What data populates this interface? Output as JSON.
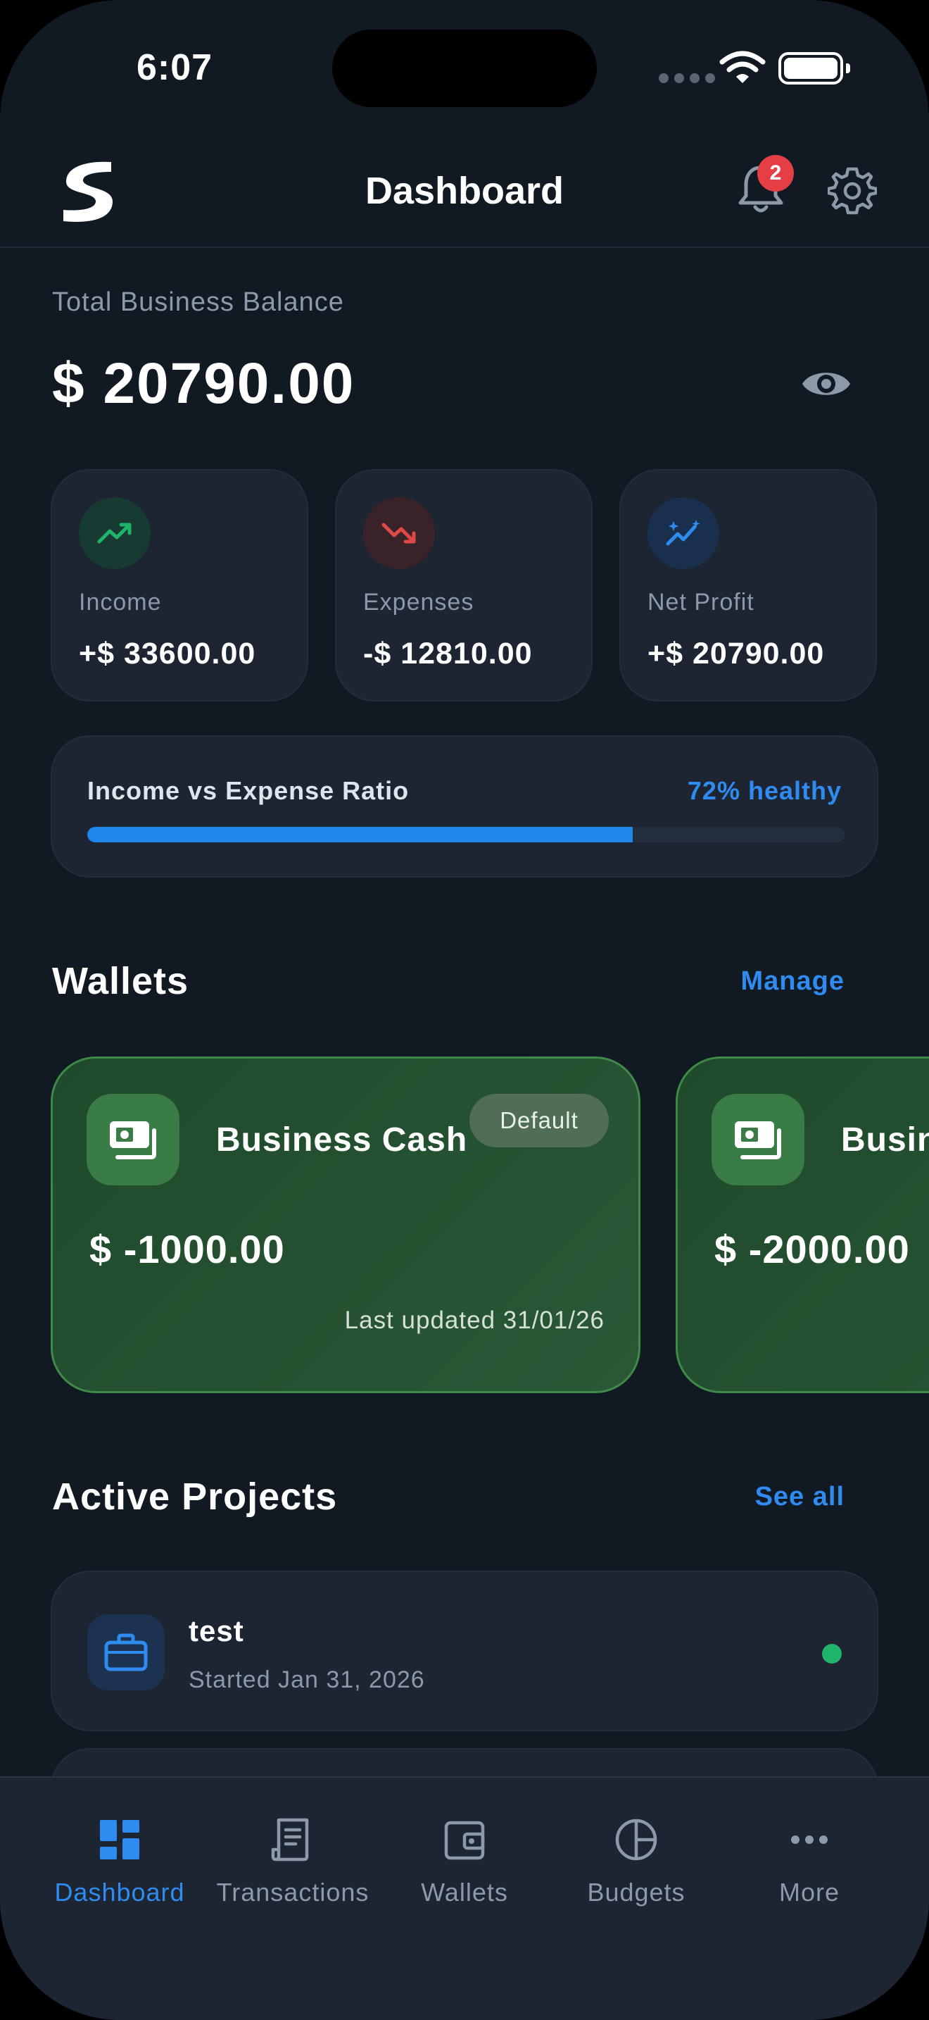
{
  "status_bar": {
    "time": "6:07"
  },
  "header": {
    "title": "Dashboard",
    "notification_count": "2"
  },
  "balance": {
    "label": "Total Business Balance",
    "value": "$ 20790.00"
  },
  "stats": [
    {
      "label": "Income",
      "value": "+$ 33600.00",
      "icon": "trending-up-icon",
      "color": "#1fb46a"
    },
    {
      "label": "Expenses",
      "value": "-$ 12810.00",
      "icon": "trending-down-icon",
      "color": "#e04848"
    },
    {
      "label": "Net Profit",
      "value": "+$ 20790.00",
      "icon": "sparkle-chart-icon",
      "color": "#2f8bf0"
    }
  ],
  "ratio": {
    "label": "Income vs Expense Ratio",
    "status": "72% healthy",
    "percent": 72
  },
  "wallets": {
    "title": "Wallets",
    "manage_label": "Manage",
    "items": [
      {
        "name": "Business Cash",
        "badge": "Default",
        "amount": "$ -1000.00",
        "updated": "Last updated 31/01/26"
      },
      {
        "name": "Busin",
        "amount": "$ -2000.00"
      }
    ]
  },
  "projects": {
    "title": "Active Projects",
    "see_all_label": "See all",
    "items": [
      {
        "name": "test",
        "date": "Started Jan 31, 2026"
      }
    ]
  },
  "tabbar": {
    "items": [
      {
        "label": "Dashboard",
        "icon": "dashboard-icon",
        "active": true
      },
      {
        "label": "Transactions",
        "icon": "receipt-icon"
      },
      {
        "label": "Wallets",
        "icon": "wallet-icon"
      },
      {
        "label": "Budgets",
        "icon": "pie-chart-icon"
      },
      {
        "label": "More",
        "icon": "more-icon"
      }
    ]
  },
  "colors": {
    "accent": "#2f8bf0",
    "background": "#111922",
    "card": "#1c2531",
    "wallet_green": "#2a5837"
  }
}
